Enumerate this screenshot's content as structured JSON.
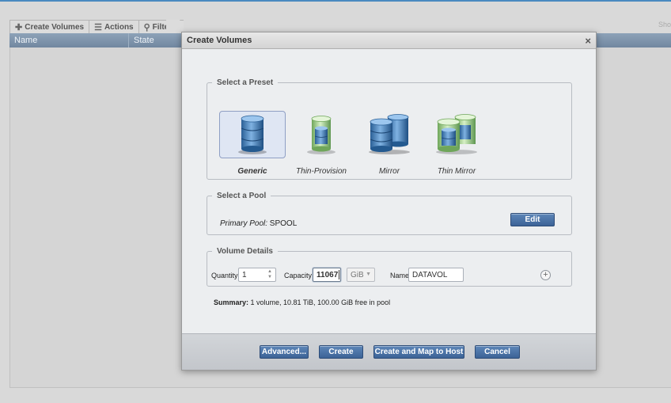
{
  "toolbar": {
    "create_volumes": "Create Volumes",
    "actions": "Actions",
    "filter": "Filter",
    "show_truncated": "Sho"
  },
  "table": {
    "columns": [
      "Name",
      "State"
    ]
  },
  "dialog": {
    "title": "Create Volumes",
    "close": "×",
    "preset_section": {
      "legend": "Select a Preset",
      "presets": [
        {
          "label": "Generic",
          "icon": "database-icon",
          "selected": true
        },
        {
          "label": "Thin-Provision",
          "icon": "thin-database-icon",
          "selected": false
        },
        {
          "label": "Mirror",
          "icon": "mirror-database-icon",
          "selected": false
        },
        {
          "label": "Thin Mirror",
          "icon": "thin-mirror-database-icon",
          "selected": false
        }
      ]
    },
    "pool_section": {
      "legend": "Select a Pool",
      "pool_label": "Primary Pool:",
      "pool_name": "SPOOL",
      "edit_label": "Edit"
    },
    "details_section": {
      "legend": "Volume Details",
      "quantity_label": "Quantity",
      "quantity_value": "1",
      "capacity_label": "Capacity",
      "capacity_value": "11067",
      "unit_value": "GiB",
      "name_label": "Name",
      "name_value": "DATAVOL",
      "add_symbol": "+"
    },
    "summary": {
      "label": "Summary:",
      "text": " 1 volume, 10.81 TiB, 100.00 GiB free in pool"
    },
    "buttons": {
      "advanced": "Advanced...",
      "create": "Create",
      "create_and_map": "Create and Map to Host",
      "cancel": "Cancel"
    }
  },
  "colors": {
    "header_blue": "#7187a0",
    "button_blue": "#3c6397",
    "generic_db": "#3f79b3",
    "thin_db": "#8fc27a"
  }
}
